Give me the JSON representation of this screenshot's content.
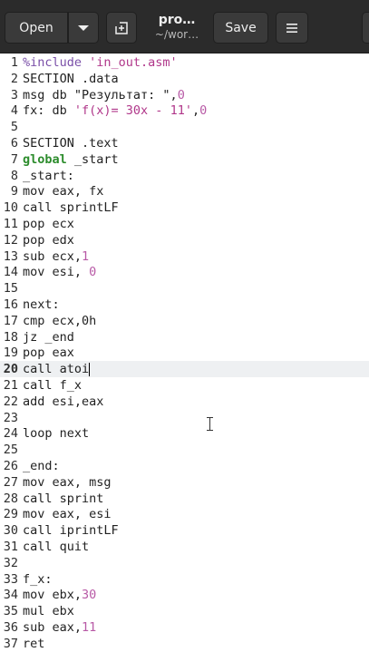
{
  "header": {
    "open_label": "Open",
    "save_label": "Save",
    "title": "pro…",
    "subtitle": "~/wor…"
  },
  "icons": {
    "open_dropdown": "chevron-down-icon",
    "new_tab": "new-document-icon",
    "menu": "hamburger-menu-icon"
  },
  "editor": {
    "current_line": 20,
    "lines": [
      {
        "n": "1",
        "tokens": [
          {
            "t": "%include ",
            "c": "pp"
          },
          {
            "t": "'in_out.asm'",
            "c": "str"
          }
        ]
      },
      {
        "n": "2",
        "tokens": [
          {
            "t": "SECTION .data",
            "c": ""
          }
        ]
      },
      {
        "n": "3",
        "tokens": [
          {
            "t": "msg db \"Результат: \",",
            "c": ""
          },
          {
            "t": "0",
            "c": "num"
          }
        ]
      },
      {
        "n": "4",
        "tokens": [
          {
            "t": "fx: db ",
            "c": ""
          },
          {
            "t": "'f(x)= 30x - 11'",
            "c": "str"
          },
          {
            "t": ",",
            "c": ""
          },
          {
            "t": "0",
            "c": "num"
          }
        ]
      },
      {
        "n": "5",
        "tokens": []
      },
      {
        "n": "6",
        "tokens": [
          {
            "t": "SECTION .text",
            "c": ""
          }
        ]
      },
      {
        "n": "7",
        "tokens": [
          {
            "t": "global",
            "c": "kw-g"
          },
          {
            "t": " _start",
            "c": ""
          }
        ]
      },
      {
        "n": "8",
        "tokens": [
          {
            "t": "_start:",
            "c": ""
          }
        ]
      },
      {
        "n": "9",
        "tokens": [
          {
            "t": "mov eax, fx",
            "c": ""
          }
        ]
      },
      {
        "n": "10",
        "tokens": [
          {
            "t": "call sprintLF",
            "c": ""
          }
        ]
      },
      {
        "n": "11",
        "tokens": [
          {
            "t": "pop ecx",
            "c": ""
          }
        ]
      },
      {
        "n": "12",
        "tokens": [
          {
            "t": "pop edx",
            "c": ""
          }
        ]
      },
      {
        "n": "13",
        "tokens": [
          {
            "t": "sub ecx,",
            "c": ""
          },
          {
            "t": "1",
            "c": "num"
          }
        ]
      },
      {
        "n": "14",
        "tokens": [
          {
            "t": "mov esi, ",
            "c": ""
          },
          {
            "t": "0",
            "c": "num"
          }
        ]
      },
      {
        "n": "15",
        "tokens": []
      },
      {
        "n": "16",
        "tokens": [
          {
            "t": "next:",
            "c": ""
          }
        ]
      },
      {
        "n": "17",
        "tokens": [
          {
            "t": "cmp ecx,0h",
            "c": ""
          }
        ]
      },
      {
        "n": "18",
        "tokens": [
          {
            "t": "jz _end",
            "c": ""
          }
        ]
      },
      {
        "n": "19",
        "tokens": [
          {
            "t": "pop eax",
            "c": ""
          }
        ]
      },
      {
        "n": "20",
        "tokens": [
          {
            "t": "call atoi",
            "c": ""
          }
        ]
      },
      {
        "n": "21",
        "tokens": [
          {
            "t": "call f_x",
            "c": ""
          }
        ]
      },
      {
        "n": "22",
        "tokens": [
          {
            "t": "add esi,eax",
            "c": ""
          }
        ]
      },
      {
        "n": "23",
        "tokens": []
      },
      {
        "n": "24",
        "tokens": [
          {
            "t": "loop next",
            "c": ""
          }
        ]
      },
      {
        "n": "25",
        "tokens": []
      },
      {
        "n": "26",
        "tokens": [
          {
            "t": "_end:",
            "c": ""
          }
        ]
      },
      {
        "n": "27",
        "tokens": [
          {
            "t": "mov eax, msg",
            "c": ""
          }
        ]
      },
      {
        "n": "28",
        "tokens": [
          {
            "t": "call sprint",
            "c": ""
          }
        ]
      },
      {
        "n": "29",
        "tokens": [
          {
            "t": "mov eax, esi",
            "c": ""
          }
        ]
      },
      {
        "n": "30",
        "tokens": [
          {
            "t": "call iprintLF",
            "c": ""
          }
        ]
      },
      {
        "n": "31",
        "tokens": [
          {
            "t": "call quit",
            "c": ""
          }
        ]
      },
      {
        "n": "32",
        "tokens": []
      },
      {
        "n": "33",
        "tokens": [
          {
            "t": "f_x:",
            "c": ""
          }
        ]
      },
      {
        "n": "34",
        "tokens": [
          {
            "t": "mov ebx,",
            "c": ""
          },
          {
            "t": "30",
            "c": "num"
          }
        ]
      },
      {
        "n": "35",
        "tokens": [
          {
            "t": "mul ebx",
            "c": ""
          }
        ]
      },
      {
        "n": "36",
        "tokens": [
          {
            "t": "sub eax,",
            "c": ""
          },
          {
            "t": "11",
            "c": "num"
          }
        ]
      },
      {
        "n": "37",
        "tokens": [
          {
            "t": "ret",
            "c": ""
          }
        ]
      }
    ]
  }
}
